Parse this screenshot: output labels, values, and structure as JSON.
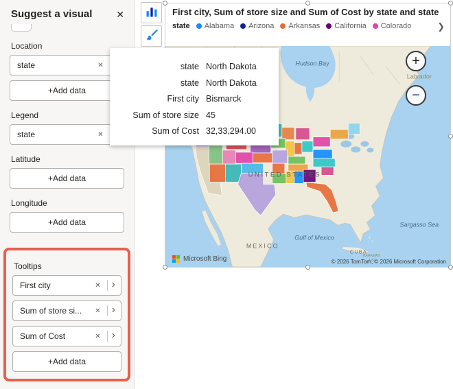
{
  "icons": {
    "close": "✕",
    "remove": "✕",
    "chevron_right": "›",
    "legend_next": "❯"
  },
  "panel": {
    "title": "Suggest a visual",
    "sections": {
      "location": {
        "label": "Location",
        "field": "state",
        "add_label": "+Add data"
      },
      "legend": {
        "label": "Legend",
        "field": "state"
      },
      "latitude": {
        "label": "Latitude",
        "add_label": "+Add data"
      },
      "longitude": {
        "label": "Longitude",
        "add_label": "+Add data"
      },
      "tooltips": {
        "label": "Tooltips",
        "fields": [
          "First city",
          "Sum of store si...",
          "Sum of Cost"
        ],
        "add_label": "+Add data",
        "highlight_color": "#E8604C"
      }
    }
  },
  "visual": {
    "title": "First city, Sum of store size and Sum of Cost by state and state",
    "legend": {
      "title": "state",
      "items": [
        {
          "label": "Alabama",
          "color": "#118DFF"
        },
        {
          "label": "Arizona",
          "color": "#12239E"
        },
        {
          "label": "Arkansas",
          "color": "#E66C37"
        },
        {
          "label": "California",
          "color": "#6B007B"
        },
        {
          "label": "Colorado",
          "color": "#E044A7"
        }
      ]
    },
    "map": {
      "labels": {
        "hudson_bay": "Hudson Bay",
        "labrador": "Labrador",
        "united_states": "UNITED STATES",
        "gulf_of_mexico": "Gulf of Mexico",
        "mexico": "MEXICO",
        "cuba": "CUBA",
        "sargasso_sea": "Sargasso Sea",
        "bahamas": "BAHAMAS",
        "bahamas_us": "(US)"
      },
      "zoom_in": "+",
      "zoom_out": "−",
      "bing_logo": "Microsoft Bing",
      "attribution": "© 2026 TomTom, © 2026 Microsoft Corporation",
      "ms_logo_colors": [
        "#F25022",
        "#7FBA00",
        "#00A4EF",
        "#FFB900"
      ]
    }
  },
  "tooltip": {
    "rows": [
      {
        "label": "state",
        "value": "North Dakota"
      },
      {
        "label": "state",
        "value": "North Dakota"
      },
      {
        "label": "First city",
        "value": "Bismarck"
      },
      {
        "label": "Sum of store size",
        "value": "45"
      },
      {
        "label": "Sum of Cost",
        "value": "32,33,294.00"
      }
    ]
  }
}
